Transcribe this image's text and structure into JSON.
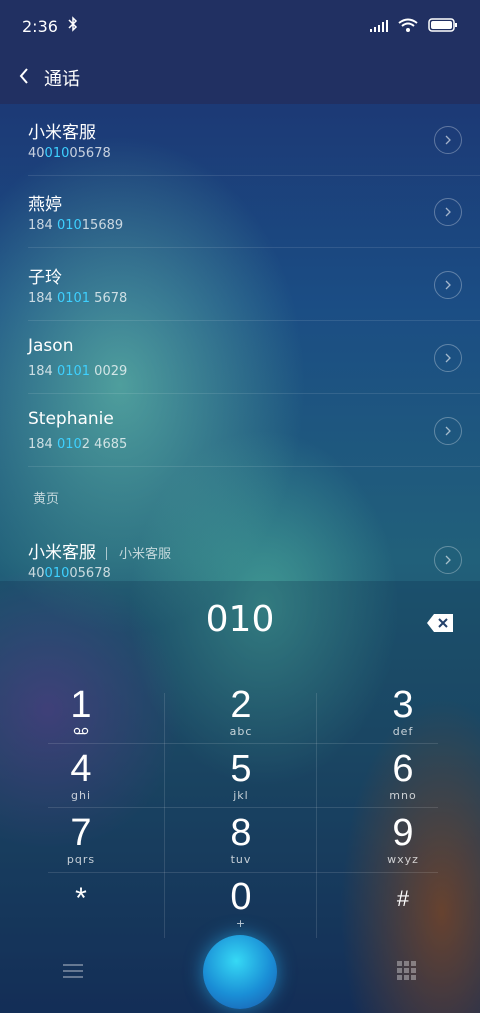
{
  "status": {
    "time": "2:36"
  },
  "header": {
    "title": "通话"
  },
  "results": [
    {
      "name": "小米客服",
      "number_pre": "40",
      "number_hl": "010",
      "number_post": "05678"
    },
    {
      "name": "燕婷",
      "number_pre": "184 ",
      "number_hl": "010",
      "number_post": "15689"
    },
    {
      "name": "子玲",
      "number_pre": "184 ",
      "number_hl": "0101",
      "number_post": " 5678"
    },
    {
      "name": "Jason",
      "number_pre": "184 ",
      "number_hl": "0101",
      "number_post": " 0029"
    },
    {
      "name": "Stephanie",
      "number_pre": "184 ",
      "number_hl": "010",
      "number_post": "2 4685"
    }
  ],
  "yellow_pages": {
    "section_label": "黄页",
    "name": "小米客服",
    "subtitle": "小米客服",
    "number_pre": "40",
    "number_hl": "010",
    "number_post": "05678"
  },
  "dialer": {
    "input": "010",
    "keys": [
      {
        "digit": "1",
        "letters": ""
      },
      {
        "digit": "2",
        "letters": "abc"
      },
      {
        "digit": "3",
        "letters": "def"
      },
      {
        "digit": "4",
        "letters": "ghi"
      },
      {
        "digit": "5",
        "letters": "jkl"
      },
      {
        "digit": "6",
        "letters": "mno"
      },
      {
        "digit": "7",
        "letters": "pqrs"
      },
      {
        "digit": "8",
        "letters": "tuv"
      },
      {
        "digit": "9",
        "letters": "wxyz"
      },
      {
        "digit": "*",
        "letters": ""
      },
      {
        "digit": "0",
        "letters": "+"
      },
      {
        "digit": "#",
        "letters": ""
      }
    ]
  },
  "colors": {
    "highlight": "#3ed0ff",
    "bar": "#213062",
    "call": "#1a8ed6"
  }
}
